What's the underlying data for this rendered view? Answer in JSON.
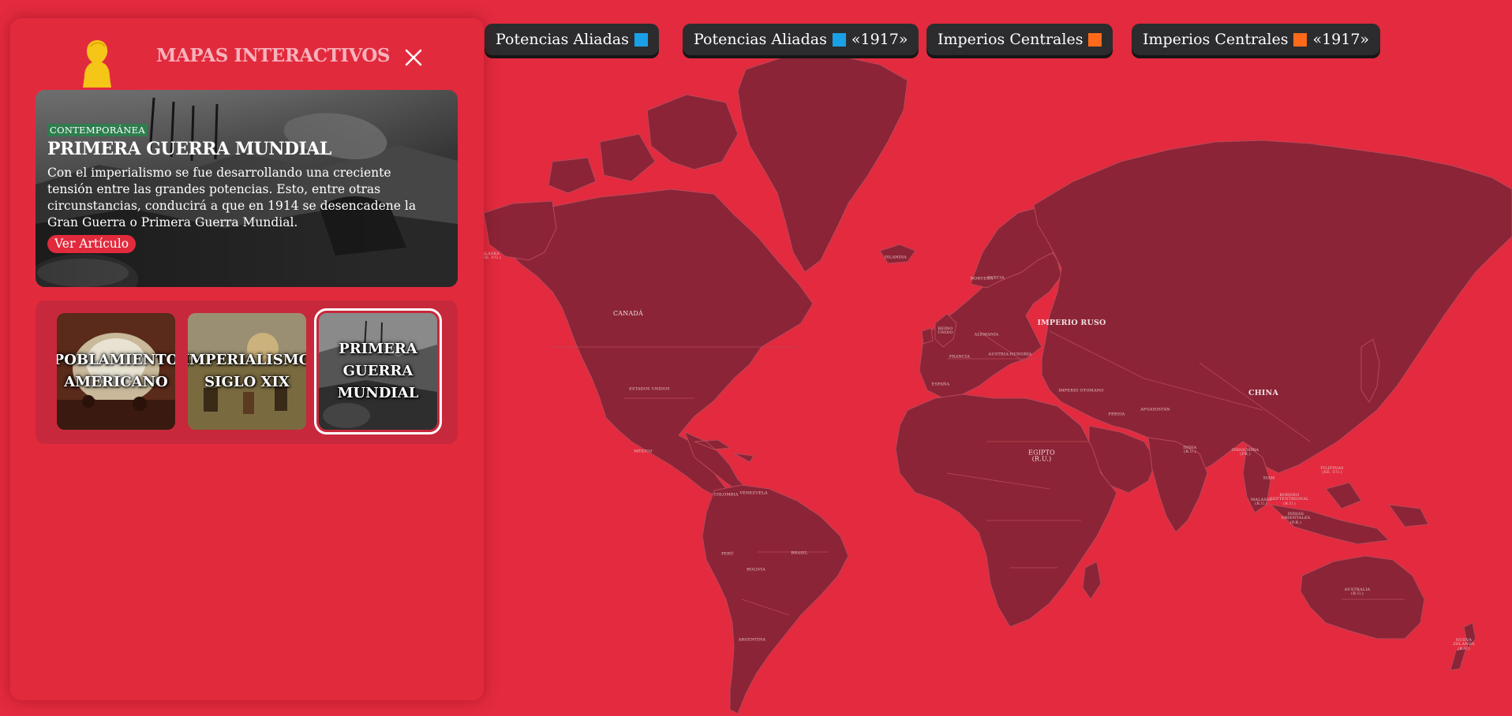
{
  "panel": {
    "title": "MAPAS INTERACTIVOS",
    "featured": {
      "tag": "CONTEMPORÁNEA",
      "title": "PRIMERA GUERRA MUNDIAL",
      "description": "Con el imperialismo se fue desarrollando una creciente tensión entre las grandes potencias. Esto, entre otras circunstancias, conducirá a que en 1914 se desencadene la Gran Guerra o Primera Guerra Mundial.",
      "link_label": "Ver Artículo"
    },
    "thumbnails": [
      {
        "label": "POBLAMIENTO AMERICANO",
        "active": false
      },
      {
        "label": "IMPERIALISMO SIGLO XIX",
        "active": false
      },
      {
        "label": "PRIMERA GUERRA MUNDIAL",
        "active": true
      }
    ]
  },
  "legend": [
    {
      "label": "Potencias Aliadas",
      "color": "#1aa0e6",
      "suffix": ""
    },
    {
      "label": "Potencias Aliadas",
      "color": "#1aa0e6",
      "suffix": "«1917»"
    },
    {
      "label": "Imperios Centrales",
      "color": "#ff6a1a",
      "suffix": ""
    },
    {
      "label": "Imperios Centrales",
      "color": "#ff6a1a",
      "suffix": "«1917»"
    }
  ],
  "map": {
    "labels": {
      "canada": "CANADÁ",
      "usa": "ESTADOS UNIDOS",
      "mexico": "MÉXICO",
      "brazil": "BRASIL",
      "peru": "PERÚ",
      "bolivia": "BOLIVIA",
      "argentina": "ARGENTINA",
      "colombia": "COLOMBIA",
      "venezuela": "VENEZUELA",
      "russia": "IMPERIO RUSO",
      "china": "CHINA",
      "india": "INDIA\n(R.U.)",
      "egypt": "EGIPTO\n(R.U.)",
      "australia": "AUSTRALIA\n(R.U.)",
      "nz": "NUEVA\nZELANDA\n(R.U.)",
      "philippines": "FILIPINAS\n(EE. UU.)",
      "ottoman": "IMPERIO OTOMANO",
      "persia": "PERSIA",
      "afghanistan": "AFGANISTÁN",
      "france": "FRANCIA",
      "spain": "ESPAÑA",
      "germany": "ALEMANIA",
      "austria": "AUSTRIA-HUNGRÍA",
      "ireland": "REINO\nUNIDO",
      "norway": "NORUEGA",
      "sweden": "SUECIA",
      "indochina": "INDOCHINA\n(FR.)",
      "siam": "SIAM",
      "malaya": "MALASIA\n(R.U.)",
      "dutch_indies": "INDIAS\nORIENTALES\n(P.B.)",
      "straits": "BORNEO\nSEPTENTRIONAL\n(R.U.)",
      "alaska": "ALASKA\n(EE. UU.)",
      "iceland": "ISLANDIA"
    }
  }
}
